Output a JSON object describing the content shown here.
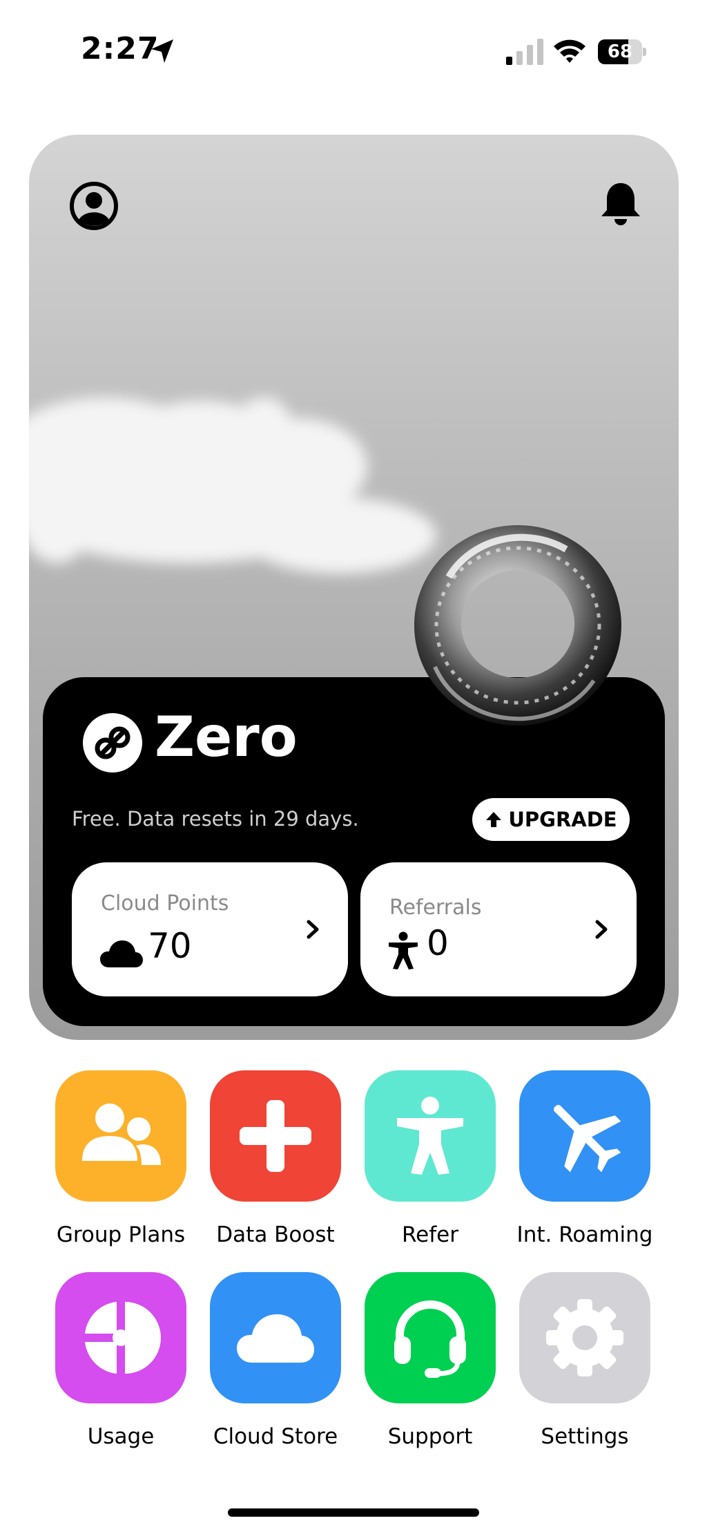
{
  "status_bar": {
    "time": "2:27",
    "battery_level": "68",
    "battery_fraction": 0.68,
    "icons": [
      "location-arrow-icon",
      "cellular-signal-icon",
      "wifi-icon",
      "battery-icon"
    ]
  },
  "hero": {
    "top_icons": [
      "profile-icon",
      "bell-icon"
    ],
    "plan": {
      "name": "Zero",
      "description": "Free. Data resets in 29 days.",
      "upgrade_label": "UPGRADE"
    },
    "stats": {
      "points": {
        "label": "Cloud Points",
        "value": "70",
        "icon": "cloud-icon"
      },
      "referrals": {
        "label": "Referrals",
        "value": "0",
        "icon": "person-icon"
      }
    }
  },
  "apps": [
    {
      "label": "Group Plans",
      "icon": "group-icon",
      "color": "#FDB12A"
    },
    {
      "label": "Data Boost",
      "icon": "plus-icon",
      "color": "#EF4436"
    },
    {
      "label": "Refer",
      "icon": "person-icon",
      "color": "#5EE8D1"
    },
    {
      "label": "Int. Roaming",
      "icon": "airplane-icon",
      "color": "#3191F5"
    },
    {
      "label": "Usage",
      "icon": "pie-chart-icon",
      "color": "#D54CEF"
    },
    {
      "label": "Cloud Store",
      "icon": "cloud-icon",
      "color": "#3191F5"
    },
    {
      "label": "Support",
      "icon": "headset-icon",
      "color": "#00D051"
    },
    {
      "label": "Settings",
      "icon": "gear-icon",
      "color": "#D2D2D7"
    }
  ]
}
